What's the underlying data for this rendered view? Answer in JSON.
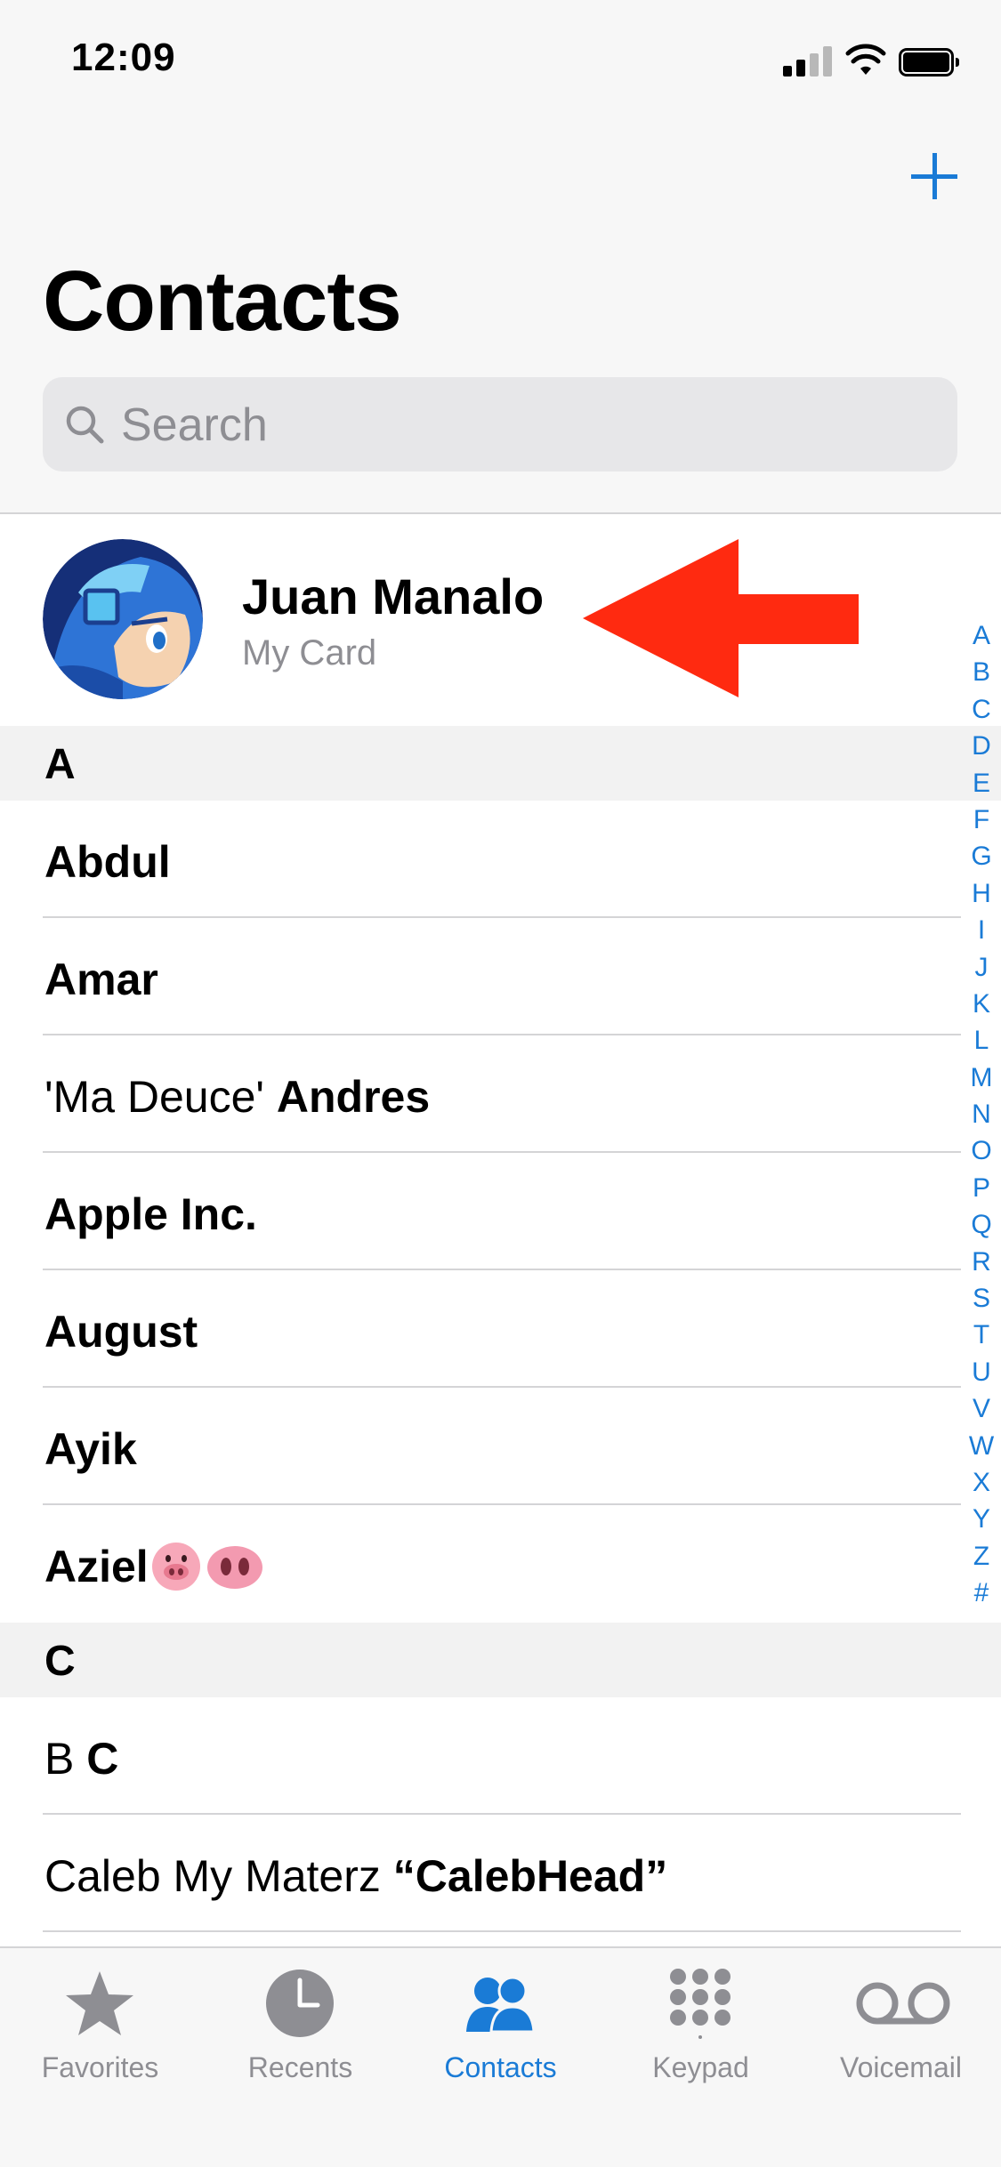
{
  "status_bar": {
    "time": "12:09"
  },
  "header": {
    "title": "Contacts"
  },
  "search": {
    "placeholder": "Search"
  },
  "my_card": {
    "name": "Juan Manalo",
    "subtitle": "My Card"
  },
  "sections": [
    {
      "letter": "A",
      "contacts": [
        {
          "prefix": "",
          "bold": "Abdul",
          "emoji": ""
        },
        {
          "prefix": "",
          "bold": "Amar",
          "emoji": ""
        },
        {
          "prefix": "'Ma Deuce' ",
          "bold": "Andres",
          "emoji": ""
        },
        {
          "prefix": "",
          "bold": "Apple Inc.",
          "emoji": ""
        },
        {
          "prefix": "",
          "bold": "August",
          "emoji": ""
        },
        {
          "prefix": "",
          "bold": "Ayik",
          "emoji": ""
        },
        {
          "prefix": "",
          "bold": "Aziel",
          "emoji": "🐷 🐽"
        }
      ]
    },
    {
      "letter": "C",
      "contacts": [
        {
          "prefix": "B ",
          "bold": "C",
          "emoji": ""
        },
        {
          "prefix": "Caleb My Materz ",
          "bold": "“CalebHead”",
          "emoji": ""
        }
      ]
    }
  ],
  "index_letters": [
    "A",
    "B",
    "C",
    "D",
    "E",
    "F",
    "G",
    "H",
    "I",
    "J",
    "K",
    "L",
    "M",
    "N",
    "O",
    "P",
    "Q",
    "R",
    "S",
    "T",
    "U",
    "V",
    "W",
    "X",
    "Y",
    "Z",
    "#"
  ],
  "tabs": [
    {
      "label": "Favorites",
      "icon": "star-icon",
      "active": false
    },
    {
      "label": "Recents",
      "icon": "clock-icon",
      "active": false
    },
    {
      "label": "Contacts",
      "icon": "people-icon",
      "active": true
    },
    {
      "label": "Keypad",
      "icon": "keypad-icon",
      "active": false
    },
    {
      "label": "Voicemail",
      "icon": "voicemail-icon",
      "active": false
    }
  ],
  "colors": {
    "accent": "#1a7bd6",
    "inactive": "#8e8e93",
    "arrow": "#ff2a10"
  }
}
